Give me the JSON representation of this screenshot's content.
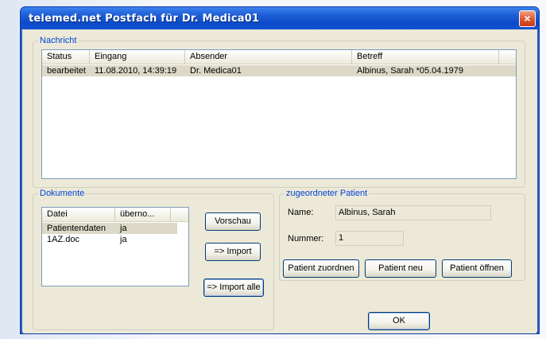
{
  "window": {
    "title": "telemed.net Postfach für Dr. Medica01",
    "close_glyph": "×"
  },
  "nachricht": {
    "group_label": "Nachricht",
    "columns": [
      "Status",
      "Eingang",
      "Absender",
      "Betreff"
    ],
    "rows": [
      {
        "status": "bearbeitet",
        "eingang": "11.08.2010, 14:39:19",
        "absender": "Dr. Medica01",
        "betreff": "Albinus, Sarah *05.04.1979"
      }
    ]
  },
  "dokumente": {
    "group_label": "Dokumente",
    "columns": [
      "Datei",
      "überno..."
    ],
    "rows": [
      {
        "datei": "Patientendaten",
        "uebernommen": "ja"
      },
      {
        "datei": "1AZ.doc",
        "uebernommen": "ja"
      }
    ]
  },
  "buttons": {
    "vorschau": "Vorschau",
    "import": "=> Import",
    "import_alle": "=> Import alle",
    "zuordnen": "Patient zuordnen",
    "neu": "Patient neu",
    "oeffnen": "Patient öffnen",
    "ok": "OK"
  },
  "patient": {
    "group_label": "zugeordneter Patient",
    "name_label": "Name:",
    "name_value": "Albinus, Sarah",
    "nummer_label": "Nummer:",
    "nummer_value": "1"
  }
}
